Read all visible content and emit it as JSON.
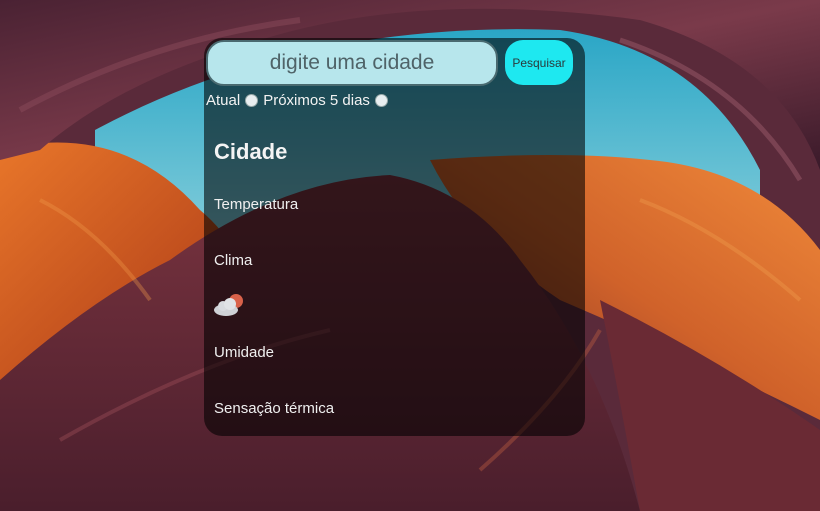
{
  "search": {
    "placeholder": "digite uma cidade",
    "button_label": "Pesquisar"
  },
  "mode": {
    "current_label": "Atual",
    "forecast_label": "Próximos 5 dias"
  },
  "weather": {
    "city": "Cidade",
    "temperature_label": "Temperatura",
    "condition_label": "Clima",
    "icon": "cloud-sun-icon",
    "humidity_label": "Umidade",
    "feels_like_label": "Sensação térmica"
  },
  "colors": {
    "panel_bg": "rgba(0,0,0,0.58)",
    "input_bg": "#b7e6ec",
    "button_bg": "#1ee8f0",
    "text": "#f2f2f2"
  }
}
